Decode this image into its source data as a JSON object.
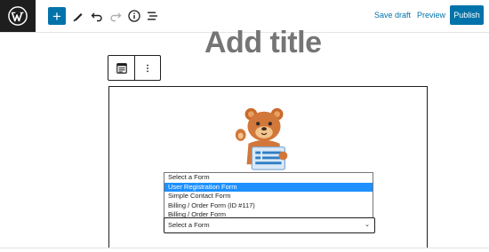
{
  "toolbar": {
    "add_label": "+",
    "save_draft_label": "Save draft",
    "preview_label": "Preview",
    "publish_label": "Publish",
    "icons": [
      "wordpress-logo-icon",
      "add-block-icon",
      "pen-tool-icon",
      "undo-icon",
      "redo-icon",
      "info-icon",
      "list-view-icon"
    ]
  },
  "editor": {
    "title_placeholder": "Add title"
  },
  "block_toolbar": {
    "icons": [
      "form-block-icon",
      "more-options-icon"
    ]
  },
  "form_block": {
    "mascot": "bear-mascot-image",
    "options": [
      "Select a Form",
      "User Registration Form",
      "Simple Contact Form",
      "Billing / Order Form (ID #117)",
      "Billing / Order Form"
    ],
    "highlighted_option": "User Registration Form",
    "selected_value": "Select a Form"
  },
  "colors": {
    "accent": "#0073aa",
    "dark": "#1e1e1e",
    "highlight": "#1e90ff",
    "placeholder": "#757575"
  }
}
